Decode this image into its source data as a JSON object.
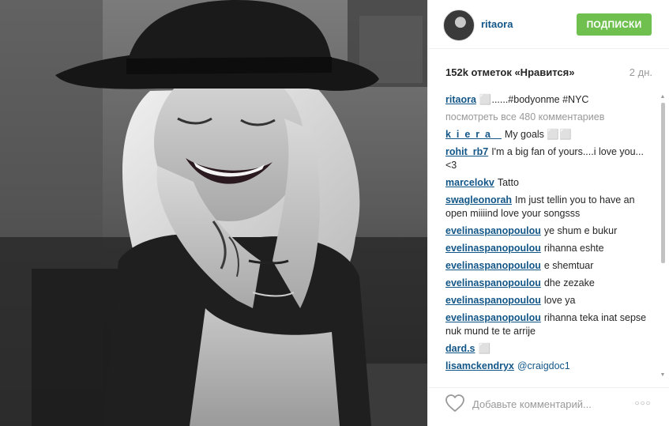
{
  "post": {
    "username": "ritaora",
    "follow_label": "ПОДПИСКИ",
    "likes_text": "152k отметок «Нравится»",
    "time_text": "2 дн."
  },
  "caption": {
    "author": "ritaora",
    "text": "⬜......#bodyonme #NYC"
  },
  "view_all_text": "посмотреть все 480 комментариев",
  "comments": [
    {
      "author": "k_i_e_r_a__",
      "text": "My goals ⬜⬜"
    },
    {
      "author": "rohit_rb7",
      "text": "I'm a big fan of yours....i love you... <3"
    },
    {
      "author": "marcelokv",
      "text": "Tatto"
    },
    {
      "author": "swagleonorah",
      "text": "Im just tellin you to have an open miiiind love your songsss"
    },
    {
      "author": "evelinaspanopoulou",
      "text": "ye shum e bukur"
    },
    {
      "author": "evelinaspanopoulou",
      "text": "rihanna eshte"
    },
    {
      "author": "evelinaspanopoulou",
      "text": "e shemtuar"
    },
    {
      "author": "evelinaspanopoulou",
      "text": "dhe zezake"
    },
    {
      "author": "evelinaspanopoulou",
      "text": "love ya"
    },
    {
      "author": "evelinaspanopoulou",
      "text": "rihanna teka inat sepse nuk mund te te arrije"
    },
    {
      "author": "dard.s",
      "text": "⬜"
    },
    {
      "author": "lisamckendryx",
      "text": "@craigdoc1",
      "is_mention": true
    }
  ],
  "comment_input": {
    "placeholder": "Добавьте комментарий..."
  },
  "icons": {
    "like": "heart-outline-icon",
    "more": "more-options-icon",
    "scroll_up": "scroll-up-arrow-icon",
    "scroll_down": "scroll-down-arrow-icon"
  },
  "colors": {
    "link_blue": "#125688",
    "follow_green": "#70c050",
    "muted_gray": "#999999",
    "divider": "#efefef"
  },
  "scroll": {
    "position_fraction": 0.0,
    "visible_fraction": 0.6
  }
}
